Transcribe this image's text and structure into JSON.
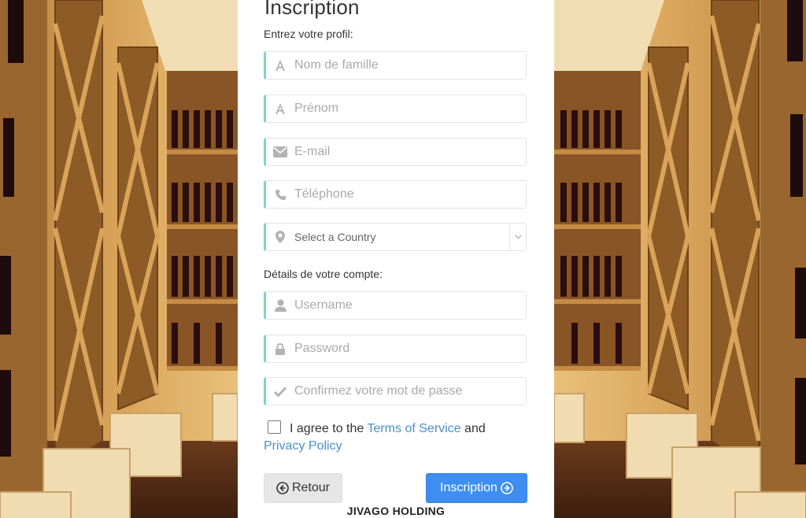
{
  "form": {
    "title": "Inscription",
    "profile_label": "Entrez votre profil:",
    "account_label": "Détails de votre compte:",
    "fields": {
      "last_name": {
        "placeholder": "Nom de famille",
        "icon": "font-icon"
      },
      "first_name": {
        "placeholder": "Prénom",
        "icon": "font-icon"
      },
      "email": {
        "placeholder": "E-mail",
        "icon": "envelope-icon"
      },
      "phone": {
        "placeholder": "Téléphone",
        "icon": "phone-icon"
      },
      "country": {
        "value": "Select a Country",
        "icon": "map-marker-icon"
      },
      "username": {
        "placeholder": "Username",
        "icon": "user-icon"
      },
      "password": {
        "placeholder": "Password",
        "icon": "lock-icon"
      },
      "confirm_password": {
        "placeholder": "Confirmez votre mot de passe",
        "icon": "check-icon"
      }
    },
    "agree": {
      "text_before": "I agree to the ",
      "terms_link": "Terms of Service",
      "text_and": " and",
      "privacy_link": "Privacy Policy",
      "checked": false
    },
    "buttons": {
      "back_label": "Retour",
      "submit_label": "Inscription"
    },
    "brand": "JIVAGO HOLDING"
  },
  "colors": {
    "accent_border": "#7fd3c6",
    "link": "#4a90c8",
    "submit_bg": "#3d8ef0",
    "back_bg": "#e6e6e6"
  }
}
